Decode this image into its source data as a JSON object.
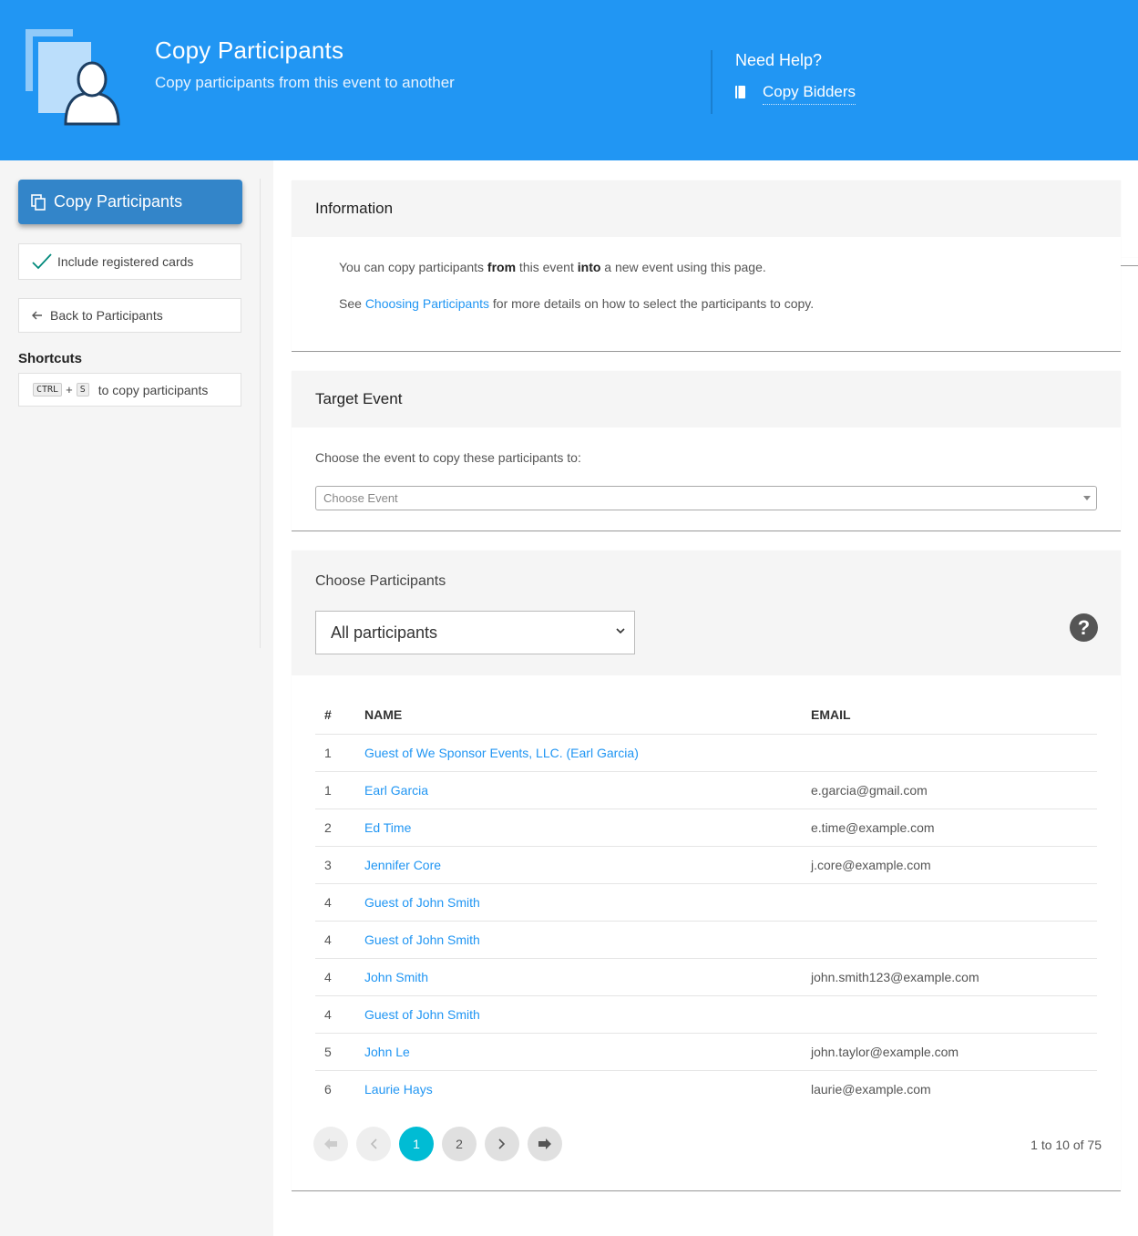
{
  "header": {
    "title": "Copy Participants",
    "subtitle": "Copy participants from this event to another",
    "help_title": "Need Help?",
    "help_link": "Copy Bidders",
    "icon": "copy-person-icon",
    "background": "#2196f3"
  },
  "sidebar": {
    "primary_button": "Copy Participants",
    "include_cards": "Include registered cards",
    "back_button": "Back to Participants",
    "shortcuts_title": "Shortcuts",
    "shortcut_key1": "CTRL",
    "shortcut_plus": "+",
    "shortcut_key2": "S",
    "shortcut_text": "to copy participants"
  },
  "info": {
    "title": "Information",
    "p1_a": "You can copy participants ",
    "p1_from": "from",
    "p1_b": " this event ",
    "p1_into": "into",
    "p1_c": " a new event using this page.",
    "p2_a": "See ",
    "p2_link": "Choosing Participants",
    "p2_b": " for more details on how to select the participants to copy."
  },
  "target": {
    "title": "Target Event",
    "label": "Choose the event to copy these participants to:",
    "placeholder": "Choose Event"
  },
  "participants": {
    "title": "Choose Participants",
    "filter_value": "All participants",
    "help_glyph": "?",
    "columns": {
      "num": "#",
      "name": "NAME",
      "email": "EMAIL"
    },
    "rows": [
      {
        "num": "1",
        "name": "Guest of We Sponsor Events, LLC. (Earl Garcia)",
        "email": ""
      },
      {
        "num": "1",
        "name": "Earl Garcia",
        "email": "e.garcia@gmail.com"
      },
      {
        "num": "2",
        "name": "Ed Time",
        "email": "e.time@example.com"
      },
      {
        "num": "3",
        "name": "Jennifer Core",
        "email": "j.core@example.com"
      },
      {
        "num": "4",
        "name": "Guest of John Smith",
        "email": ""
      },
      {
        "num": "4",
        "name": "Guest of John Smith",
        "email": ""
      },
      {
        "num": "4",
        "name": "John Smith",
        "email": "john.smith123@example.com"
      },
      {
        "num": "4",
        "name": "Guest of John Smith",
        "email": ""
      },
      {
        "num": "5",
        "name": "John Le",
        "email": "john.taylor@example.com"
      },
      {
        "num": "6",
        "name": "Laurie Hays",
        "email": "laurie@example.com"
      }
    ],
    "pager": {
      "page1": "1",
      "page2": "2",
      "info": "1 to 10 of 75"
    }
  },
  "colors": {
    "accent": "#2196f3",
    "active_page": "#00bcd4",
    "button": "#3385c9"
  }
}
